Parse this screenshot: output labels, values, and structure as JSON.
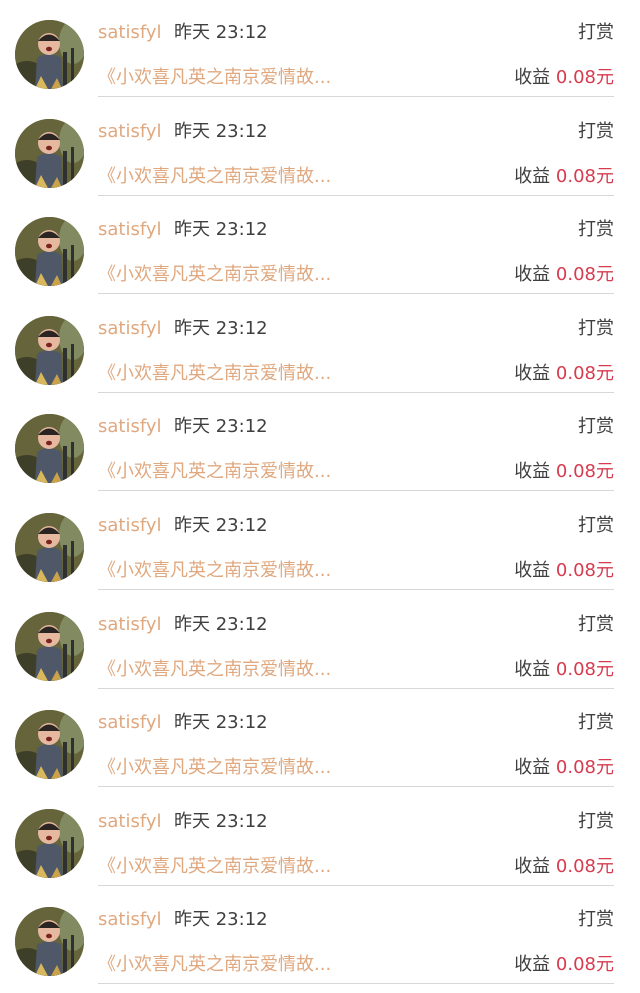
{
  "items": [
    {
      "user": "satisfyl",
      "time": "昨天 23:12",
      "type": "打赏",
      "article": "《小欢喜凡英之南京爱情故...",
      "earn_label": "收益",
      "earn_amount": "0.08元"
    },
    {
      "user": "satisfyl",
      "time": "昨天 23:12",
      "type": "打赏",
      "article": "《小欢喜凡英之南京爱情故...",
      "earn_label": "收益",
      "earn_amount": "0.08元"
    },
    {
      "user": "satisfyl",
      "time": "昨天 23:12",
      "type": "打赏",
      "article": "《小欢喜凡英之南京爱情故...",
      "earn_label": "收益",
      "earn_amount": "0.08元"
    },
    {
      "user": "satisfyl",
      "time": "昨天 23:12",
      "type": "打赏",
      "article": "《小欢喜凡英之南京爱情故...",
      "earn_label": "收益",
      "earn_amount": "0.08元"
    },
    {
      "user": "satisfyl",
      "time": "昨天 23:12",
      "type": "打赏",
      "article": "《小欢喜凡英之南京爱情故...",
      "earn_label": "收益",
      "earn_amount": "0.08元"
    },
    {
      "user": "satisfyl",
      "time": "昨天 23:12",
      "type": "打赏",
      "article": "《小欢喜凡英之南京爱情故...",
      "earn_label": "收益",
      "earn_amount": "0.08元"
    },
    {
      "user": "satisfyl",
      "time": "昨天 23:12",
      "type": "打赏",
      "article": "《小欢喜凡英之南京爱情故...",
      "earn_label": "收益",
      "earn_amount": "0.08元"
    },
    {
      "user": "satisfyl",
      "time": "昨天 23:12",
      "type": "打赏",
      "article": "《小欢喜凡英之南京爱情故...",
      "earn_label": "收益",
      "earn_amount": "0.08元"
    },
    {
      "user": "satisfyl",
      "time": "昨天 23:12",
      "type": "打赏",
      "article": "《小欢喜凡英之南京爱情故...",
      "earn_label": "收益",
      "earn_amount": "0.08元"
    },
    {
      "user": "satisfyl",
      "time": "昨天 23:12",
      "type": "打赏",
      "article": "《小欢喜凡英之南京爱情故...",
      "earn_label": "收益",
      "earn_amount": "0.08元"
    }
  ],
  "colors": {
    "username": "#e0a87f",
    "article": "#e0a87f",
    "amount": "#d63b4f",
    "text": "#3f3f3f",
    "divider": "#d7d7d7"
  }
}
